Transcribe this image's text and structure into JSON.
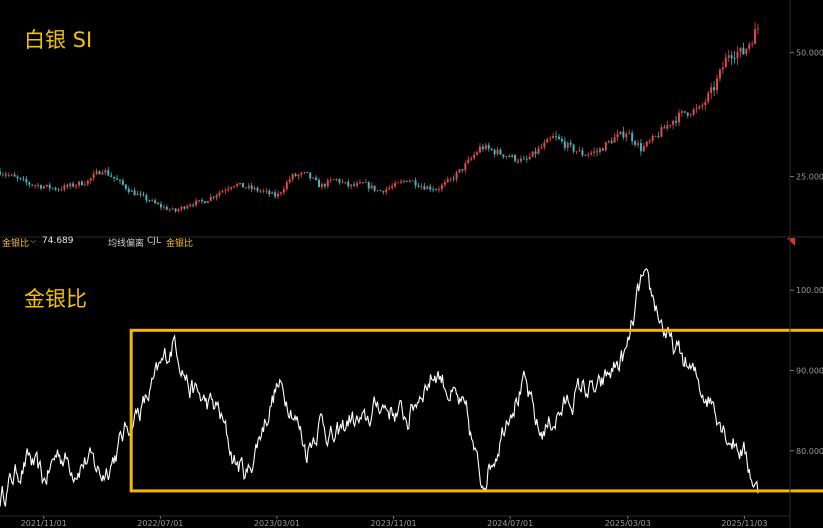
{
  "colors": {
    "background": "#000000",
    "candle_up": "#e04a4a",
    "candle_down": "#3fb6c3",
    "ratio_line": "#ffffff",
    "highlight_box": "#f5b800",
    "title": "#f2c200",
    "axis_text": "#9a9a9a"
  },
  "header": {
    "title": "白银  SI"
  },
  "indicator_bar": {
    "name": "金银比",
    "dropdown_icon": "chevron-down-icon",
    "value": "74.689",
    "tab_ma_deviation": "均线偏离",
    "tab_cjl": "CJL",
    "tab_active": "金银比"
  },
  "chart_data": [
    {
      "type": "candlestick",
      "title": "白银  SI",
      "xlabel": "",
      "ylabel": "",
      "x_start": "2021/08",
      "x_end": "2025/12",
      "ylim": [
        13,
        59
      ],
      "y_ticks": [
        25.0,
        50.0
      ],
      "y_tick_labels": [
        "25.000",
        "50.000"
      ],
      "grid": false,
      "legend": "none",
      "anchor_path": [
        [
          "2021/08",
          26
        ],
        [
          "2021/10",
          23.5
        ],
        [
          "2021/12",
          22.5
        ],
        [
          "2022/02",
          24
        ],
        [
          "2022/03",
          26.5
        ],
        [
          "2022/05",
          22
        ],
        [
          "2022/07",
          19
        ],
        [
          "2022/08",
          18
        ],
        [
          "2022/09",
          19.5
        ],
        [
          "2022/10",
          20
        ],
        [
          "2022/12",
          23.5
        ],
        [
          "2023/02",
          22
        ],
        [
          "2023/03",
          21
        ],
        [
          "2023/04",
          25
        ],
        [
          "2023/05",
          25.5
        ],
        [
          "2023/06",
          23
        ],
        [
          "2023/07",
          24.5
        ],
        [
          "2023/08",
          23
        ],
        [
          "2023/09",
          23.5
        ],
        [
          "2023/10",
          22
        ],
        [
          "2023/11",
          23
        ],
        [
          "2023/12",
          24.5
        ],
        [
          "2024/01",
          23
        ],
        [
          "2024/02",
          22.5
        ],
        [
          "2024/03",
          24.5
        ],
        [
          "2024/04",
          27.5
        ],
        [
          "2024/05",
          31
        ],
        [
          "2024/06",
          30
        ],
        [
          "2024/07",
          29
        ],
        [
          "2024/08",
          28
        ],
        [
          "2024/09",
          30.5
        ],
        [
          "2024/10",
          33
        ],
        [
          "2024/11",
          31
        ],
        [
          "2024/12",
          29.5
        ],
        [
          "2025/01",
          30
        ],
        [
          "2025/02",
          32.5
        ],
        [
          "2025/03",
          34
        ],
        [
          "2025/04",
          30.5
        ],
        [
          "2025/05",
          33
        ],
        [
          "2025/06",
          36
        ],
        [
          "2025/07",
          38
        ],
        [
          "2025/08",
          38.5
        ],
        [
          "2025/09",
          43
        ],
        [
          "2025/10",
          50
        ],
        [
          "2025/11",
          50
        ],
        [
          "2025/12",
          55
        ]
      ]
    },
    {
      "type": "line",
      "title": "金银比",
      "xlabel": "",
      "ylabel": "",
      "x_ticks": [
        "2021/11/01",
        "2022/07/01",
        "2023/03/01",
        "2023/11/01",
        "2024/07/01",
        "2025/03/03",
        "2025/11/03"
      ],
      "ylim": [
        72,
        105
      ],
      "y_ticks": [
        80.0,
        90.0,
        100.0
      ],
      "y_tick_labels": [
        "80.000",
        "90.000",
        "100.000"
      ],
      "grid": false,
      "legend": "none",
      "current_value": 74.689,
      "highlight_box": {
        "x_from": "2022/05",
        "x_to": "2025/12",
        "y_from": 75.0,
        "y_to": 95.0
      },
      "series": [
        {
          "values": [
            [
              "2021/08",
              74
            ],
            [
              "2021/09",
              77
            ],
            [
              "2021/10",
              79
            ],
            [
              "2021/11",
              76
            ],
            [
              "2021/12",
              80
            ],
            [
              "2022/01",
              78
            ],
            [
              "2022/02",
              79
            ],
            [
              "2022/03",
              77
            ],
            [
              "2022/04",
              80
            ],
            [
              "2022/05",
              84
            ],
            [
              "2022/06",
              86
            ],
            [
              "2022/07",
              90
            ],
            [
              "2022/08",
              94
            ],
            [
              "2022/09",
              88
            ],
            [
              "2022/10",
              86
            ],
            [
              "2022/11",
              85
            ],
            [
              "2022/12",
              79
            ],
            [
              "2023/01",
              77
            ],
            [
              "2023/02",
              83
            ],
            [
              "2023/03",
              88
            ],
            [
              "2023/04",
              86
            ],
            [
              "2023/05",
              80
            ],
            [
              "2023/06",
              84
            ],
            [
              "2023/07",
              81
            ],
            [
              "2023/08",
              84
            ],
            [
              "2023/09",
              83
            ],
            [
              "2023/10",
              86
            ],
            [
              "2023/11",
              85
            ],
            [
              "2023/12",
              84
            ],
            [
              "2024/01",
              88
            ],
            [
              "2024/02",
              90
            ],
            [
              "2024/03",
              87
            ],
            [
              "2024/04",
              84
            ],
            [
              "2024/05",
              76
            ],
            [
              "2024/06",
              80
            ],
            [
              "2024/07",
              86
            ],
            [
              "2024/08",
              88
            ],
            [
              "2024/09",
              82
            ],
            [
              "2024/10",
              84
            ],
            [
              "2024/11",
              86
            ],
            [
              "2024/12",
              88
            ],
            [
              "2025/01",
              87
            ],
            [
              "2025/02",
              90
            ],
            [
              "2025/03",
              92
            ],
            [
              "2025/04",
              101
            ],
            [
              "2025/05",
              98
            ],
            [
              "2025/06",
              93
            ],
            [
              "2025/07",
              91
            ],
            [
              "2025/08",
              88
            ],
            [
              "2025/09",
              86
            ],
            [
              "2025/10",
              82
            ],
            [
              "2025/11",
              80
            ],
            [
              "2025/12",
              74.689
            ]
          ]
        }
      ]
    }
  ]
}
